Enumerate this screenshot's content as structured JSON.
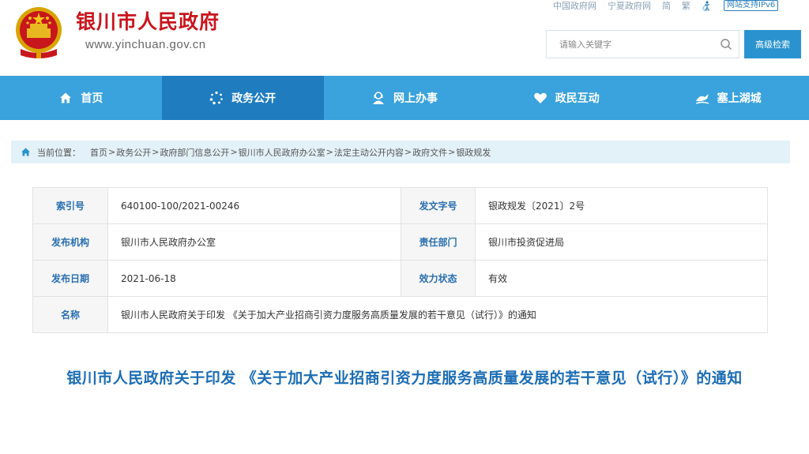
{
  "header": {
    "site_name": "银川市人民政府",
    "site_url": "www.yinchuan.gov.cn",
    "top_links": [
      "中国政府网",
      "宁夏政府网",
      "简",
      "繁"
    ],
    "ipv6_badge": "网站支持IPv6",
    "search": {
      "placeholder": "请输入关键字"
    },
    "advanced_search_label": "高级检索"
  },
  "nav": {
    "items": [
      {
        "label": "首页",
        "icon": "home-icon"
      },
      {
        "label": "政务公开",
        "icon": "open-gov-icon",
        "active": true
      },
      {
        "label": "网上办事",
        "icon": "service-icon"
      },
      {
        "label": "政民互动",
        "icon": "interaction-icon"
      },
      {
        "label": "塞上湖城",
        "icon": "city-icon"
      }
    ]
  },
  "breadcrumb": {
    "label": "当前位置：",
    "items": [
      "首页",
      "政务公开",
      "政府部门信息公开",
      "银川市人民政府办公室",
      "法定主动公开内容",
      "政府文件",
      "银政规发"
    ],
    "separator": ">"
  },
  "info": {
    "index_no_label": "索引号",
    "index_no": "640100-100/2021-00246",
    "doc_no_label": "发文字号",
    "doc_no": "银政规发〔2021〕2号",
    "issuer_label": "发布机构",
    "issuer": "银川市人民政府办公室",
    "dept_label": "责任部门",
    "dept": "银川市投资促进局",
    "date_label": "发布日期",
    "date": "2021-06-18",
    "status_label": "效力状态",
    "status": "有效",
    "name_label": "名称",
    "name": "银川市人民政府关于印发 《关于加大产业招商引资力度服务高质量发展的若干意见（试行）》的通知"
  },
  "doc_title": "银川市人民政府关于印发 《关于加大产业招商引资力度服务高质量发展的若干意见（试行）》的通知",
  "colors": {
    "brand_red": "#c8161d",
    "nav_blue": "#3aa2dc",
    "nav_active": "#1f7cbf",
    "title_blue": "#1c6db3",
    "label_blue": "#2a6fb0",
    "breadcrumb_bg": "#e3f1f9"
  }
}
